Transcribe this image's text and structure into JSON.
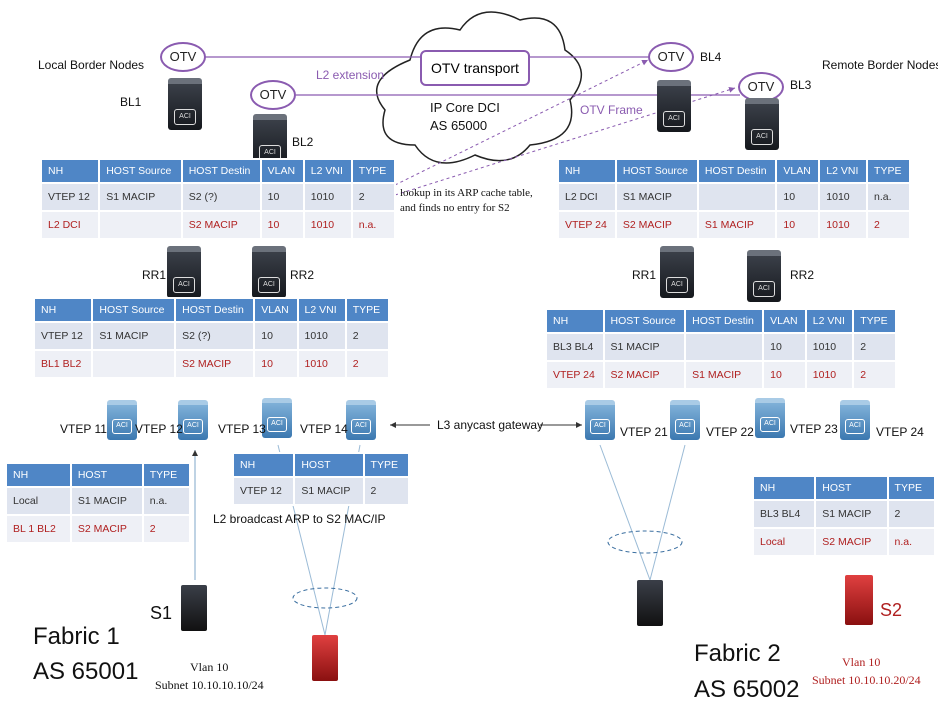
{
  "labels": {
    "local_border": "Local Border Nodes",
    "remote_border": "Remote Border Nodes",
    "bl1": "BL1",
    "bl2": "BL2",
    "bl3": "BL3",
    "bl4": "BL4",
    "rr1_l": "RR1",
    "rr2_l": "RR2",
    "rr1_r": "RR1",
    "rr2_r": "RR2",
    "l2_extension": "L2 extension",
    "otv_transport": "OTV transport",
    "ip_core": "IP Core DCI",
    "as_core": "AS 65000",
    "otv_frame": "OTV Frame",
    "lookup": "lookup in its ARP cache table,",
    "lookup2": "and finds no entry for S2",
    "vtep11": "VTEP 11",
    "vtep12": "VTEP 12",
    "vtep13": "VTEP 13",
    "vtep14": "VTEP 14",
    "vtep21": "VTEP 21",
    "vtep22": "VTEP 22",
    "vtep23": "VTEP 23",
    "vtep24": "VTEP 24",
    "anycast": "L3 anycast gateway",
    "broadcast": "L2 broadcast ARP to S2 MAC/IP",
    "s1": "S1",
    "s2": "S2",
    "fabric1": "Fabric 1",
    "as1": "AS 65001",
    "fabric2": "Fabric 2",
    "as2": "AS 65002",
    "vlan_l": "Vlan 10",
    "subnet_l": "Subnet 10.10.10.10/24",
    "vlan_r": "Vlan 10",
    "subnet_r": "Subnet 10.10.10.20/24",
    "otv": "OTV",
    "aci": "ACI"
  },
  "colors": {
    "header": "#4f86c6",
    "red_text": "#b02020",
    "otv_purple": "#8a5bb0"
  },
  "tables": {
    "bl_left": {
      "headers": [
        "NH",
        "HOST  Source",
        "HOST Destin",
        "VLAN",
        "L2 VNI",
        "TYPE"
      ],
      "rows": [
        [
          "VTEP 12",
          "S1 MACIP",
          "S2 (?)",
          "10",
          "1010",
          "2"
        ],
        [
          "L2 DCI",
          "",
          "S2 MACIP",
          "10",
          "1010",
          "n.a."
        ]
      ]
    },
    "rr_left": {
      "headers": [
        "NH",
        "HOST  Source",
        "HOST Destin",
        "VLAN",
        "L2 VNI",
        "TYPE"
      ],
      "rows": [
        [
          "VTEP 12",
          "S1 MACIP",
          "S2 (?)",
          "10",
          "1010",
          "2"
        ],
        [
          "BL1  BL2",
          "",
          "S2 MACIP",
          "10",
          "1010",
          "2"
        ]
      ]
    },
    "bl_right": {
      "headers": [
        "NH",
        "HOST  Source",
        "HOST Destin",
        "VLAN",
        "L2 VNI",
        "TYPE"
      ],
      "rows": [
        [
          "L2 DCI",
          "S1 MACIP",
          "",
          "10",
          "1010",
          "n.a."
        ],
        [
          "VTEP 24",
          "S2 MACIP",
          "S1 MACIP",
          "10",
          "1010",
          "2"
        ]
      ]
    },
    "rr_right": {
      "headers": [
        "NH",
        "HOST  Source",
        "HOST Destin",
        "VLAN",
        "L2 VNI",
        "TYPE"
      ],
      "rows": [
        [
          "BL3  BL4",
          "S1 MACIP",
          "",
          "10",
          "1010",
          "2"
        ],
        [
          "VTEP 24",
          "S2 MACIP",
          "S1 MACIP",
          "10",
          "1010",
          "2"
        ]
      ]
    },
    "vtep_left": {
      "headers": [
        "NH",
        "HOST",
        "TYPE"
      ],
      "rows": [
        [
          "Local",
          "S1 MACIP",
          "n.a."
        ],
        [
          "BL 1  BL2",
          "S2 MACIP",
          "2"
        ]
      ]
    },
    "vtep_mid": {
      "headers": [
        "NH",
        "HOST",
        "TYPE"
      ],
      "rows": [
        [
          "VTEP 12",
          "S1 MACIP",
          "2"
        ]
      ]
    },
    "vtep_right": {
      "headers": [
        "NH",
        "HOST",
        "TYPE"
      ],
      "rows": [
        [
          "BL3 BL4",
          "S1 MACIP",
          "2"
        ],
        [
          "Local",
          "S2 MACIP",
          "n.a."
        ]
      ]
    }
  }
}
